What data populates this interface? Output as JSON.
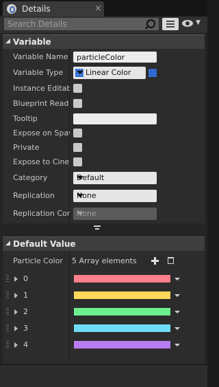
{
  "tab": {
    "title": "Details",
    "close": "×"
  },
  "search": {
    "placeholder": "Search Details"
  },
  "variable_section": {
    "title": "Variable",
    "rows": {
      "name_label": "Variable Name",
      "name_value": "particleColor",
      "type_label": "Variable Type",
      "type_value": "Linear Color",
      "instance_label": "Instance Editable",
      "bp_readonly_label": "Blueprint Read Only",
      "tooltip_label": "Tooltip",
      "tooltip_value": "",
      "expose_spawn_label": "Expose on Spawn",
      "private_label": "Private",
      "expose_cine_label": "Expose to Cinematics",
      "category_label": "Category",
      "category_value": "Default",
      "replication_label": "Replication",
      "replication_value": "None",
      "rep_cond_label": "Replication Condition",
      "rep_cond_value": "None"
    }
  },
  "default_section": {
    "title": "Default Value",
    "property_label": "Particle Color",
    "array_summary": "5 Array elements",
    "elements": [
      {
        "index": "0",
        "color": "#ff7f8a"
      },
      {
        "index": "1",
        "color": "#ffd85c"
      },
      {
        "index": "2",
        "color": "#6cf08f"
      },
      {
        "index": "3",
        "color": "#6fdcf7"
      },
      {
        "index": "4",
        "color": "#b97cf0"
      }
    ]
  }
}
